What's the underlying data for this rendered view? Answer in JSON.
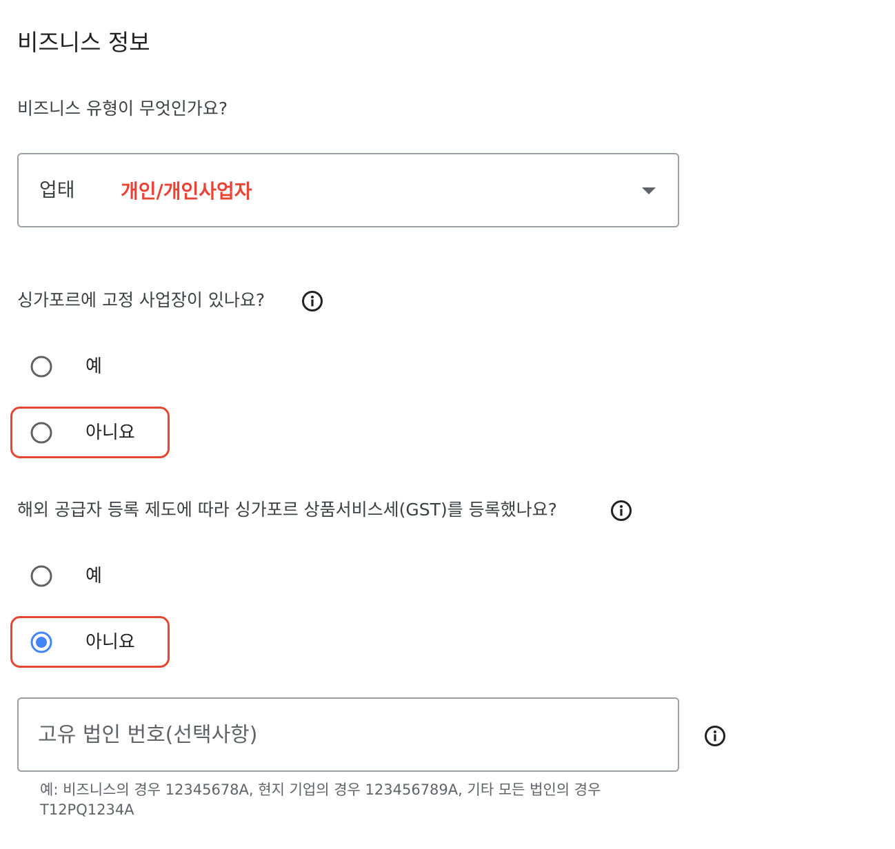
{
  "section": {
    "title": "비즈니스 정보"
  },
  "business_type": {
    "question": "비즈니스 유형이 무엇인가요?",
    "field_label": "업태",
    "selected_value": "개인/개인사업자"
  },
  "fixed_place": {
    "question": "싱가포르에 고정 사업장이 있나요?",
    "options": [
      {
        "label": "예",
        "selected": false
      },
      {
        "label": "아니요",
        "selected": false
      }
    ]
  },
  "gst": {
    "question": "해외 공급자 등록 제도에 따라 싱가포르 상품서비스세(GST)를 등록했나요?",
    "options": [
      {
        "label": "예",
        "selected": false
      },
      {
        "label": "아니요",
        "selected": true
      }
    ]
  },
  "uen": {
    "placeholder": "고유 법인 번호(선택사항)",
    "value": "",
    "helper": "예: 비즈니스의 경우 12345678A, 현지 기업의 경우 123456789A, 기타 모든 법인의 경우 T12PQ1234A"
  },
  "colors": {
    "accent_red": "#ea4335",
    "highlight_border": "#e8452e",
    "radio_selected": "#4285f4",
    "radio_unselected": "#5f6368"
  },
  "icons": {
    "info": "info-circle-icon",
    "dropdown": "arrow-drop-down-icon"
  }
}
